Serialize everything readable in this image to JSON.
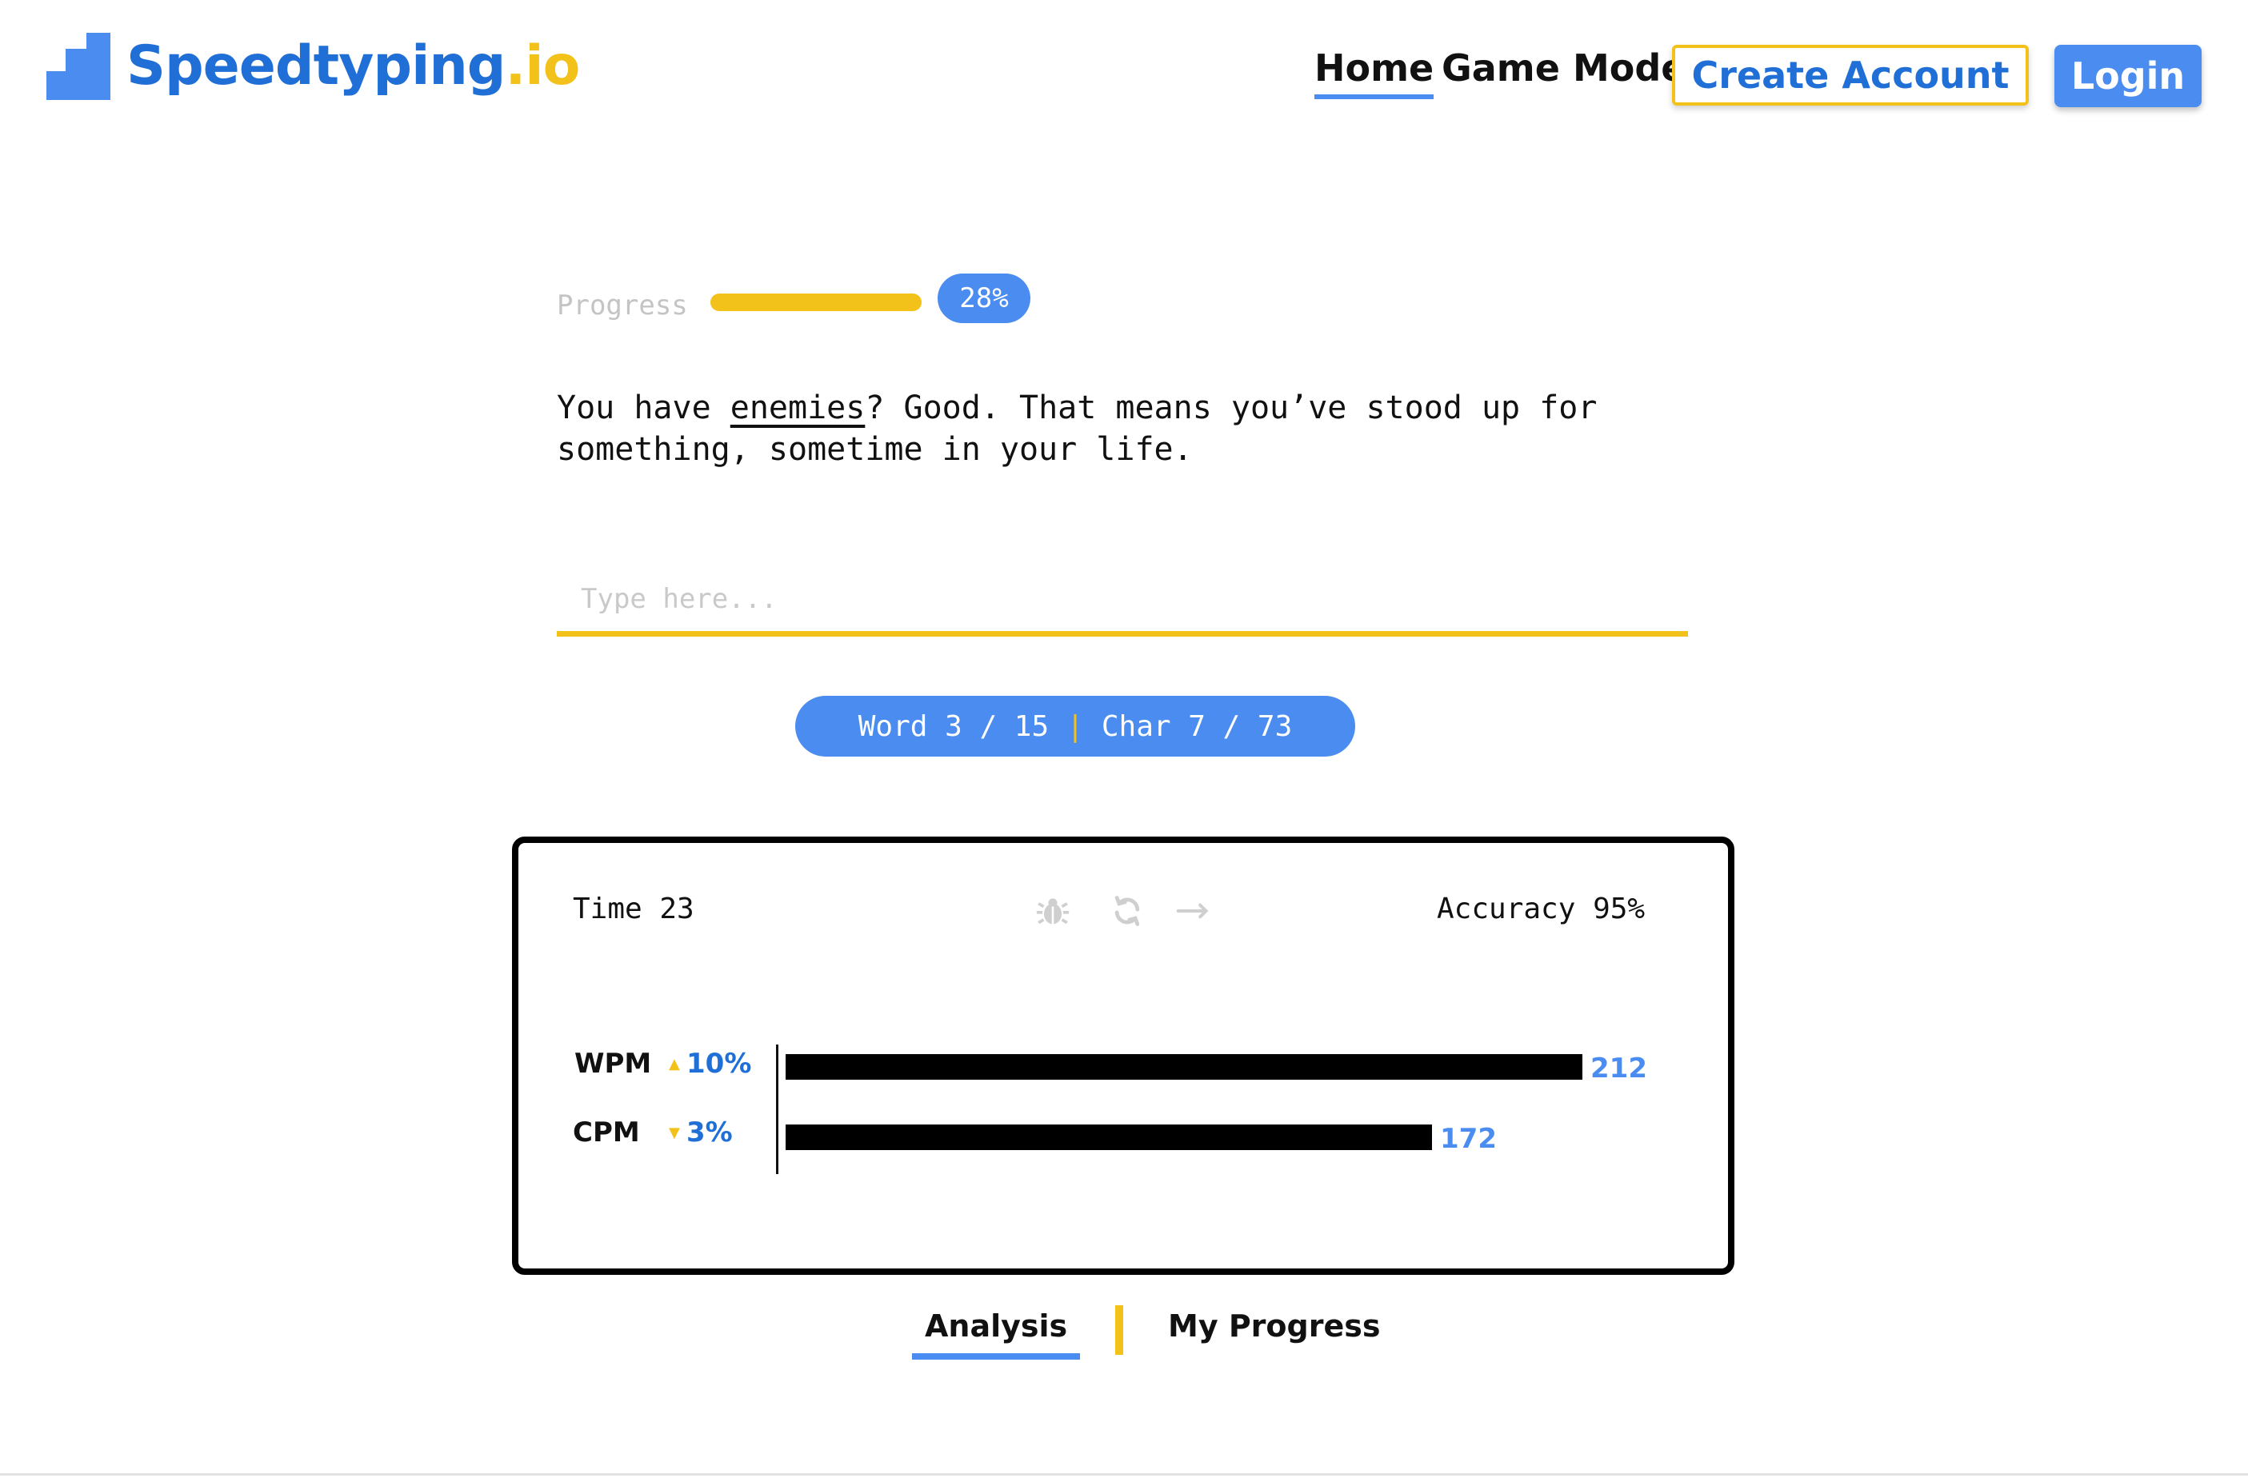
{
  "header": {
    "logo_main": "Speedtyping",
    "logo_suffix": ".io",
    "nav": {
      "home": "Home",
      "game_mode": "Game Mode"
    },
    "create_account": "Create Account",
    "login": "Login"
  },
  "progress": {
    "label": "Progress",
    "percent_text": "28%",
    "value": 0.28
  },
  "quote": {
    "before": "You have ",
    "current_word": "enemies",
    "after": "? Good. That means you’ve stood up for something, sometime in your life."
  },
  "input": {
    "placeholder": "Type here...",
    "value": ""
  },
  "counter": {
    "word_label": "Word 3 / 15",
    "char_label": "Char 7 / 73",
    "separator": "|"
  },
  "stats": {
    "time_label": "Time 23",
    "accuracy_label": "Accuracy 95%",
    "icons": [
      "bug-icon",
      "refresh-icon",
      "arrow-right-icon"
    ],
    "metrics": [
      {
        "label": "WPM",
        "direction": "up",
        "change": "10%",
        "value": 212
      },
      {
        "label": "CPM",
        "direction": "down",
        "change": "3%",
        "value": 172
      }
    ]
  },
  "tabs": {
    "analysis": "Analysis",
    "my_progress": "My Progress"
  },
  "colors": {
    "brand_blue": "#4a8cf0",
    "brand_dark_blue": "#1f6fd6",
    "accent_yellow": "#f2c21b"
  }
}
